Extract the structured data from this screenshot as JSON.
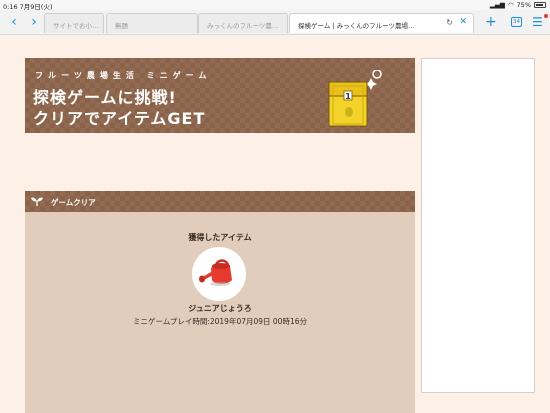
{
  "status_bar": {
    "time_date": "0:16  7月9日(火)",
    "battery": "75%"
  },
  "tabs": [
    {
      "title": "サイトでお小…",
      "active": false
    },
    {
      "title": "無題",
      "active": false
    },
    {
      "title": "みっくんのフルーツ農…",
      "active": false
    },
    {
      "title": "探検ゲーム | みっくんのフルーツ農場…",
      "active": true
    }
  ],
  "toolbar": {
    "tab_count": "34"
  },
  "banner": {
    "subtitle": "フルーツ農場生活 ミニゲーム",
    "line1": "探検ゲームに挑戦!",
    "line2": "クリアでアイテムGET"
  },
  "panel": {
    "heading": "ゲームクリア",
    "acquired_label": "獲得したアイテム",
    "item_name": "ジュニアじょうろ",
    "play_time": "ミニゲームプレイ時間:2019年07月09日 00時16分"
  },
  "colors": {
    "accent": "#1a8fd6",
    "brown": "#8a6248",
    "panel_bg": "#e2cdbd",
    "page_bg": "#fdf0e6"
  }
}
